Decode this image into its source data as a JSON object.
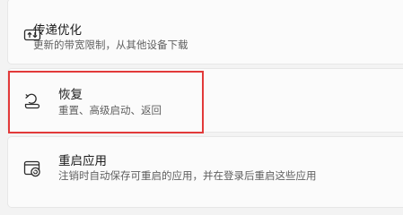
{
  "settings": {
    "items": [
      {
        "title": "传递优化",
        "description": "更新的带宽限制，从其他设备下载",
        "icon": "delivery-optimization-icon"
      },
      {
        "title": "恢复",
        "description": "重置、高级启动、返回",
        "icon": "recovery-icon"
      },
      {
        "title": "重启应用",
        "description": "注销时自动保存可重启的应用，并在登录后重启这些应用",
        "icon": "restart-apps-icon"
      }
    ]
  },
  "colors": {
    "background": "#f3f3f3",
    "card": "#fbfbfb",
    "highlight_border": "#e23a3a",
    "title_text": "#1b1b1b",
    "description_text": "#5f5f5f"
  }
}
